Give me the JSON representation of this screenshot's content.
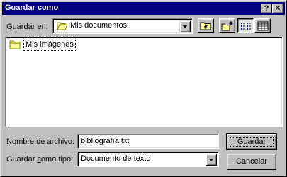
{
  "dialog": {
    "title": "Guardar como",
    "help_button": "?",
    "close_button": "✕"
  },
  "toolbar": {
    "save_in_label_pre": "",
    "save_in_label_accel": "G",
    "save_in_label_post": "uardar en:",
    "current_folder": "Mis documentos",
    "icons": [
      "up-one-level-icon",
      "new-folder-icon",
      "list-view-icon",
      "details-view-icon"
    ]
  },
  "file_list": {
    "items": [
      {
        "name": "Mis imágenes",
        "icon": "folder-icon"
      }
    ]
  },
  "filename": {
    "label_accel": "N",
    "label_rest": "ombre de archivo:",
    "value": "bibliografía.txt"
  },
  "filetype": {
    "label_pre": "Guardar ",
    "label_accel": "c",
    "label_post": "omo tipo:",
    "value": "Documento de texto"
  },
  "buttons": {
    "save_accel": "G",
    "save_rest": "uardar",
    "cancel": "Cancelar"
  },
  "colors": {
    "titlebar": "#000080",
    "face": "#c0c0c0",
    "folder": "#ffff99"
  }
}
